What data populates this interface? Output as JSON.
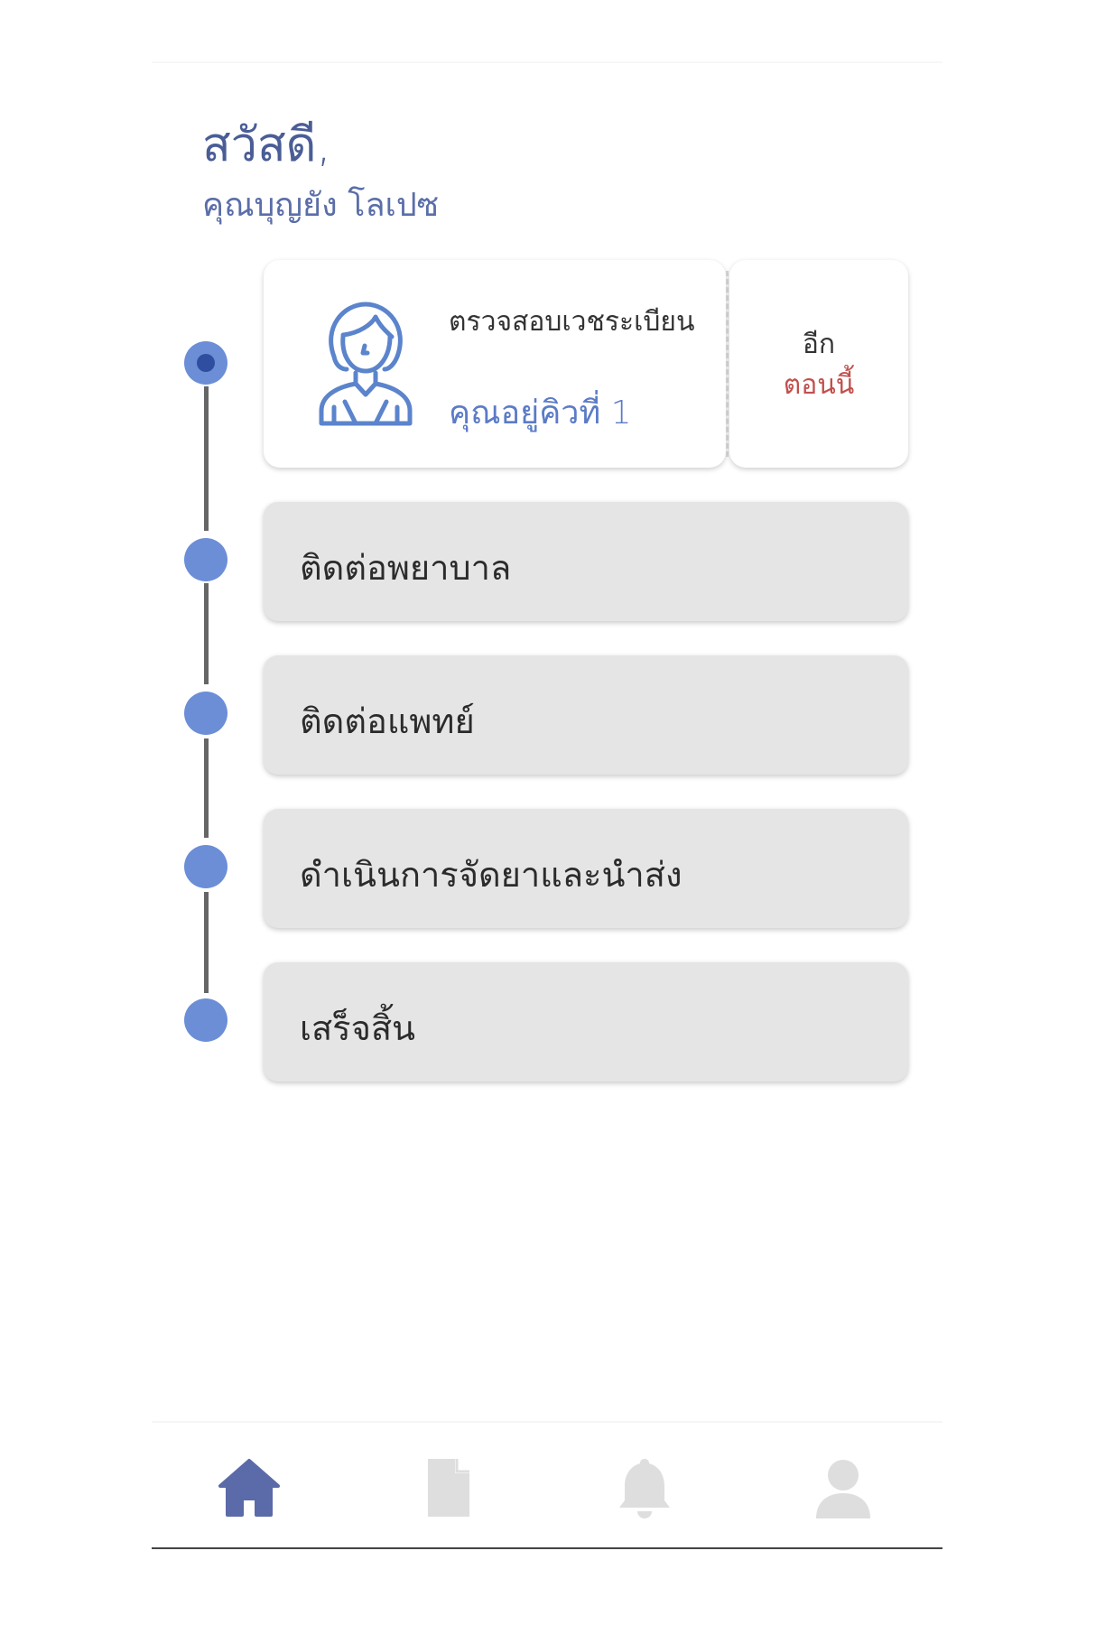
{
  "greeting": "สวัสดี,",
  "user_name": "คุณบุญยัง โลเปซ",
  "current_step": {
    "title": "ตรวจสอบเวชระเบียน",
    "queue": "คุณอยู่คิวที่ 1",
    "remaining_label": "อีก",
    "remaining_value": "ตอนนี้"
  },
  "steps": [
    {
      "label": "ติดต่อพยาบาล"
    },
    {
      "label": "ติดต่อแพทย์"
    },
    {
      "label": "ดำเนินการจัดยาและนำส่ง"
    },
    {
      "label": "เสร็จสิ้น"
    }
  ],
  "nav": {
    "items": [
      {
        "icon": "home-icon",
        "active": true
      },
      {
        "icon": "document-icon",
        "active": false
      },
      {
        "icon": "bell-icon",
        "active": false
      },
      {
        "icon": "user-icon",
        "active": false
      }
    ]
  },
  "colors": {
    "primary": "#4a5d96",
    "dot": "#6b8ed6",
    "dot_active": "#2f4ea0",
    "accent_red": "#c0504d",
    "step_bg": "#e5e5e5"
  }
}
